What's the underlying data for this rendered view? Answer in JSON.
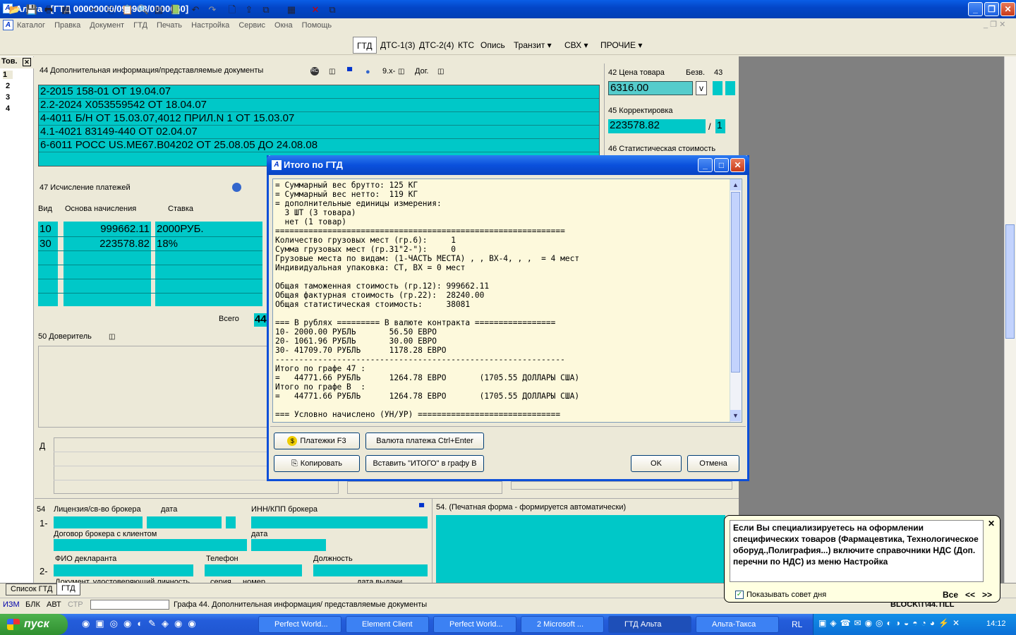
{
  "window": {
    "title": "Альта - [ГТД 00000000/090908/0000060]"
  },
  "menu": [
    "Каталог",
    "Правка",
    "Документ",
    "ГТД",
    "Печать",
    "Настройка",
    "Сервис",
    "Окна",
    "Помощь"
  ],
  "tabs": [
    "ГТД",
    "ДТС-1(3)",
    "ДТС-2(4)",
    "КТС",
    "Опись",
    "Транзит ▾",
    "СВХ ▾",
    "ПРОЧИЕ ▾"
  ],
  "left": {
    "header": "Тов.",
    "items": [
      "1",
      "2",
      "3",
      "4"
    ]
  },
  "box44": {
    "label": "44 Дополнительная информация/представляемые документы",
    "x_label": "9.x-",
    "dog_label": "Дог.",
    "rows": [
      "2-2015 158-01 ОТ 19.04.07",
      "2.2-2024 X053559542 ОТ 18.04.07",
      "4-4011 Б/Н ОТ 15.03.07,4012 ПРИЛ.N 1 ОТ 15.03.07",
      "4.1-4021 83149-440 ОТ 02.04.07",
      "6-6011 РОСС US.ME67.B04202 ОТ 25.08.05 ДО 24.08.08"
    ]
  },
  "box42": {
    "label": "42 Цена товара",
    "bezv": "Безв.",
    "value": "6316.00",
    "check": "v"
  },
  "box43": {
    "label": "43"
  },
  "box45": {
    "label": "45 Корректировка",
    "value": "223578.82",
    "slash": "/",
    "code": "1"
  },
  "box46": {
    "label": "46 Статистическая стоимость"
  },
  "box47": {
    "label": "47 Исчисление платежей",
    "headers": [
      "Вид",
      "Основа начисления",
      "Ставка"
    ],
    "rows": [
      [
        "10",
        "999662.11",
        "2000РУБ."
      ],
      [
        "30",
        "223578.82",
        "18%"
      ]
    ],
    "total_label": "Всего",
    "total_value": "44"
  },
  "box50": {
    "label": "50 Доверитель"
  },
  "boxD": {
    "label": "Д"
  },
  "box54": {
    "num": "54",
    "license": "Лицензия/св-во брокера",
    "date1": "дата",
    "inn": "ИНН/КПП брокера",
    "row1": "1-",
    "contract": "Договор брокера с клиентом",
    "date2": "дата",
    "fio": "ФИО декларанта",
    "phone": "Телефон",
    "position": "Должность",
    "row2": "2-",
    "doc": "Документ, удостоверяющий личность",
    "series": "серия",
    "number": "номер",
    "issued": "дата выдачи",
    "print_label": "54. (Печатная форма - формируется автоматически)"
  },
  "bottom_tabs": [
    "Список ГТД",
    "ГТД"
  ],
  "status": {
    "items": [
      "ИЗМ",
      "БЛК",
      "АВТ",
      "СТР"
    ],
    "text": "Графа 44. Дополнительная информация/ представляемые документы",
    "block": "BLOCK\\T\\44.TILL"
  },
  "dialog": {
    "title": "Итого по ГТД",
    "report": "= Суммарный вес брутто: 125 КГ\n= Суммарный вес нетто:  119 КГ\n= дополнительные единицы измерения:\n  3 ШТ (3 товара)\n  нет (1 товар)\n=============================================================\nКоличество грузовых мест (гр.6):     1\nСумма грузовых мест (гр.31\"2-\"):     0\nГрузовые места по видам: (1-ЧАСТЬ МЕСТА) , , ВХ-4, , ,  = 4 мест\nИндивидуальная упаковка: СТ, ВХ = 0 мест\n\nОбщая таможенная стоимость (гр.12): 999662.11\nОбщая фактурная стоимость (гр.22):  28240.00\nОбщая статистическая стоимость:     38081\n\n=== В рублях ========= В валюте контракта =================\n10- 2000.00 РУБЛЬ       56.50 ЕВРО\n20- 1061.96 РУБЛЬ       30.00 ЕВРО\n30- 41709.70 РУБЛЬ      1178.28 ЕВРО\n-------------------------------------------------------------\nИтого по графе 47 :\n=   44771.66 РУБЛЬ      1264.78 ЕВРО       (1705.55 ДОЛЛАРЫ США)\nИтого по графе В  :\n=   44771.66 РУБЛЬ      1264.78 ЕВРО       (1705.55 ДОЛЛАРЫ США)\n\n=== Условно начислено (УН/УР) ==============================",
    "btn_payments": "Платежки  F3",
    "btn_currency": "Валюта платежа   Ctrl+Enter",
    "btn_copy": "Копировать",
    "btn_insert": "Вставить \"ИТОГО\" в графу В",
    "btn_ok": "OK",
    "btn_cancel": "Отмена"
  },
  "tip": {
    "text": "Если Вы специализируетесь на оформлении специфических товаров (Фармацевтика, Технологическое оборуд.,Полиграфия...) включите справочники НДС (Доп. перечни по НДС) из меню Настройка",
    "show_label": "Показывать совет дня",
    "all": "Все",
    "prev": "<<",
    "next": ">>"
  },
  "taskbar": {
    "start": "пуск",
    "tasks": [
      "Perfect World...",
      "Element Client",
      "Perfect World...",
      "2 Microsoft ...",
      "ГТД Альта",
      "Альта-Такса"
    ],
    "lang": "RL",
    "clock": "14:12"
  }
}
